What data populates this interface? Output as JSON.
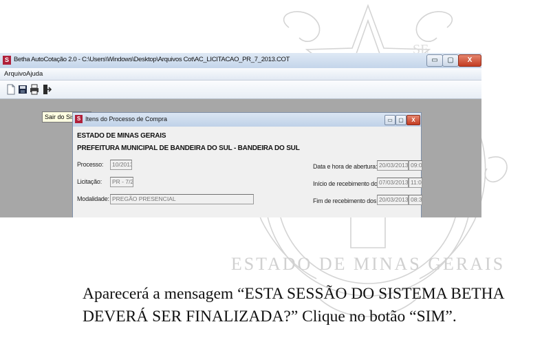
{
  "watermark": {
    "text_bottom": "ESTADO DE MINAS GERAIS",
    "text_top_fragment": "SE"
  },
  "app_window": {
    "title": "Betha AutoCotação 2.0 - C:\\Users\\Windows\\Desktop\\Arquivos Cot\\AC_LICITACAO_PR_7_2013.COT",
    "icon_letter": "S",
    "controls": {
      "minimize": "▭",
      "maximize": "▢",
      "close": "X"
    },
    "menu": [
      "Arquivo",
      "Ajuda"
    ],
    "toolbar_icons": [
      "new-file-icon",
      "save-icon",
      "print-icon",
      "exit-icon"
    ],
    "tooltip": "Sair do Sistema"
  },
  "dialog": {
    "title": "Itens do Processo de Compra",
    "icon_letter": "S",
    "controls": {
      "minimize": "▭",
      "maximize": "▢",
      "close": "X"
    },
    "state": "ESTADO DE MINAS GERAIS",
    "city": "PREFEITURA MUNICIPAL DE BANDEIRA DO SUL - BANDEIRA DO SUL",
    "fields": {
      "processo": {
        "label": "Processo:",
        "value": "10/2013"
      },
      "licitacao": {
        "label": "Licitação:",
        "value": "PR - 7/2013"
      },
      "modalidade": {
        "label": "Modalidade:",
        "value": "PREGÃO PRESENCIAL"
      }
    },
    "dates": {
      "abertura": {
        "label": "Data e hora de abertura:",
        "date": "20/03/2013",
        "time": "09:00"
      },
      "inicio": {
        "label": "Início de recebimento dos envelopes:",
        "date": "07/03/2013",
        "time": "11:00"
      },
      "fim": {
        "label": "Fim de recebimento dos envelopes:",
        "date": "20/03/2013",
        "time": "08:30"
      }
    }
  },
  "instruction": {
    "line1": "Aparecerá a mensagem “ESTA SESSÃO DO SISTEMA BETHA",
    "line2": "DEVERÁ SER FINALIZADA?” Clique no botão “SIM”."
  }
}
